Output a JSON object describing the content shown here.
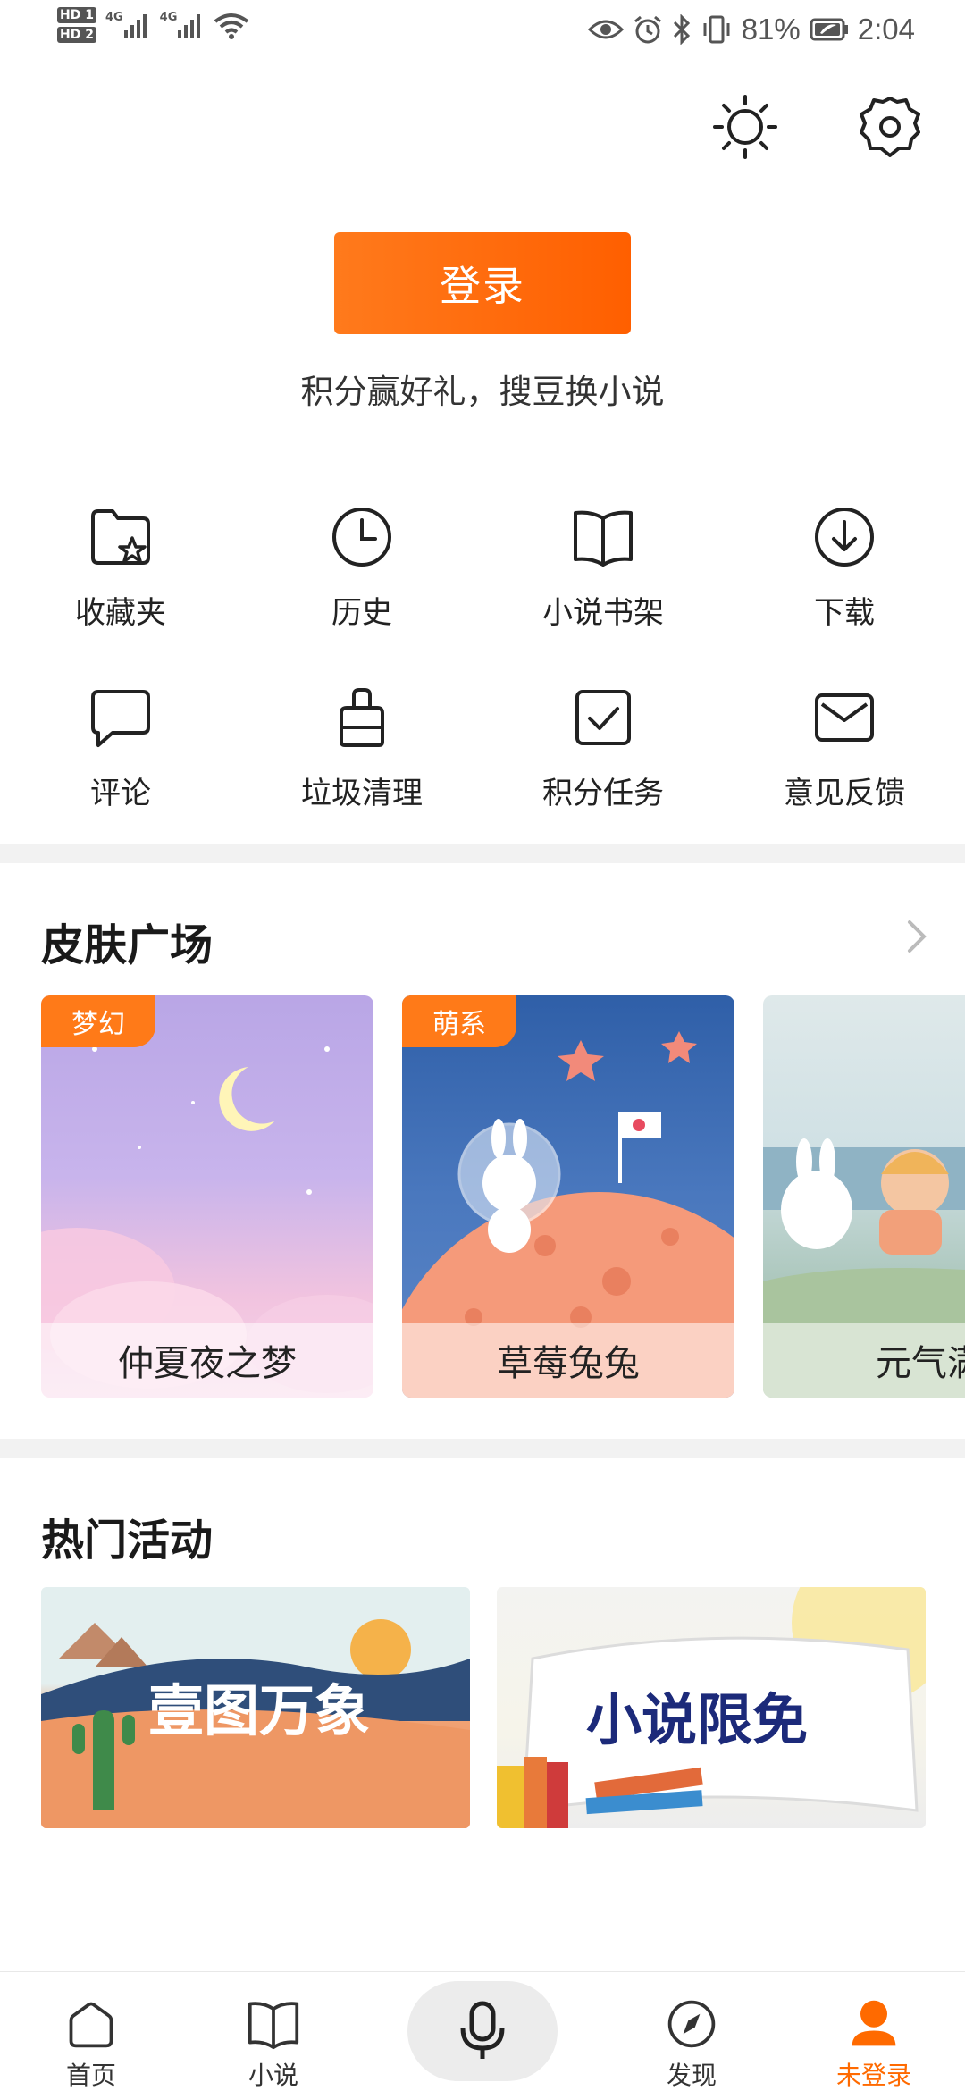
{
  "status_bar": {
    "sim1": "HD 1",
    "sim2": "HD 2",
    "net1": "4G",
    "net2": "4G",
    "battery": "81%",
    "time": "2:04"
  },
  "header": {
    "icons": [
      "brightness-icon",
      "settings-icon"
    ]
  },
  "login": {
    "button_label": "登录",
    "tip": "积分赢好礼，搜豆换小说"
  },
  "grid": [
    {
      "label": "收藏夹",
      "icon": "favorites-folder-icon"
    },
    {
      "label": "历史",
      "icon": "history-clock-icon"
    },
    {
      "label": "小说书架",
      "icon": "bookshelf-icon"
    },
    {
      "label": "下载",
      "icon": "download-icon"
    },
    {
      "label": "评论",
      "icon": "comment-icon"
    },
    {
      "label": "垃圾清理",
      "icon": "cleanup-icon"
    },
    {
      "label": "积分任务",
      "icon": "points-task-icon"
    },
    {
      "label": "意见反馈",
      "icon": "feedback-mail-icon"
    }
  ],
  "skins": {
    "title": "皮肤广场",
    "items": [
      {
        "tag": "梦幻",
        "name": "仲夏夜之梦"
      },
      {
        "tag": "萌系",
        "name": "草莓兔兔"
      },
      {
        "tag": "",
        "name": "元气满"
      }
    ]
  },
  "activities": {
    "title": "热门活动",
    "items": [
      {
        "text": "壹图万象"
      },
      {
        "text": "小说限免"
      }
    ]
  },
  "bottom_nav": [
    {
      "label": "首页",
      "icon": "home-icon"
    },
    {
      "label": "小说",
      "icon": "book-icon"
    },
    {
      "label": "",
      "icon": "microphone-icon"
    },
    {
      "label": "发现",
      "icon": "compass-icon"
    },
    {
      "label": "未登录",
      "icon": "user-icon"
    }
  ],
  "colors": {
    "accent": "#ff6a00",
    "divider": "#f2f2f2"
  }
}
